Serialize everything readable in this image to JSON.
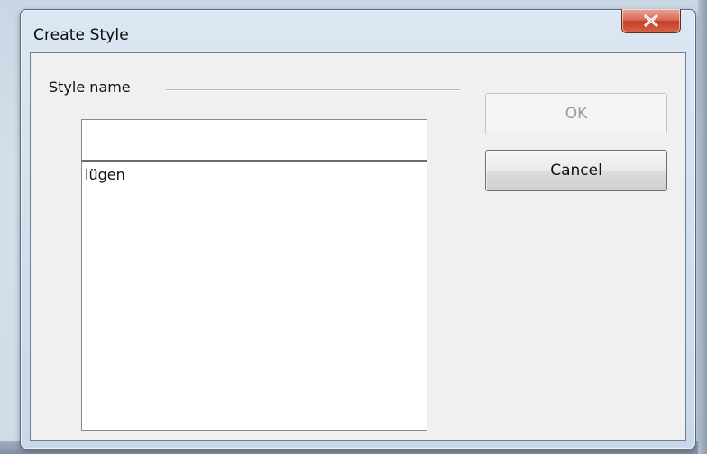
{
  "window": {
    "title": "Create Style"
  },
  "group": {
    "label": "Style name"
  },
  "name_input": {
    "value": "",
    "placeholder": ""
  },
  "styles_list": {
    "items": [
      {
        "label": "lügen"
      }
    ]
  },
  "buttons": {
    "ok_label": "OK",
    "ok_enabled": false,
    "cancel_label": "Cancel"
  },
  "icons": {
    "close": "close-icon"
  },
  "colors": {
    "close_button": "#c43e27",
    "dialog_background": "#f0f0f0",
    "disabled_text": "#9a9a9a"
  }
}
